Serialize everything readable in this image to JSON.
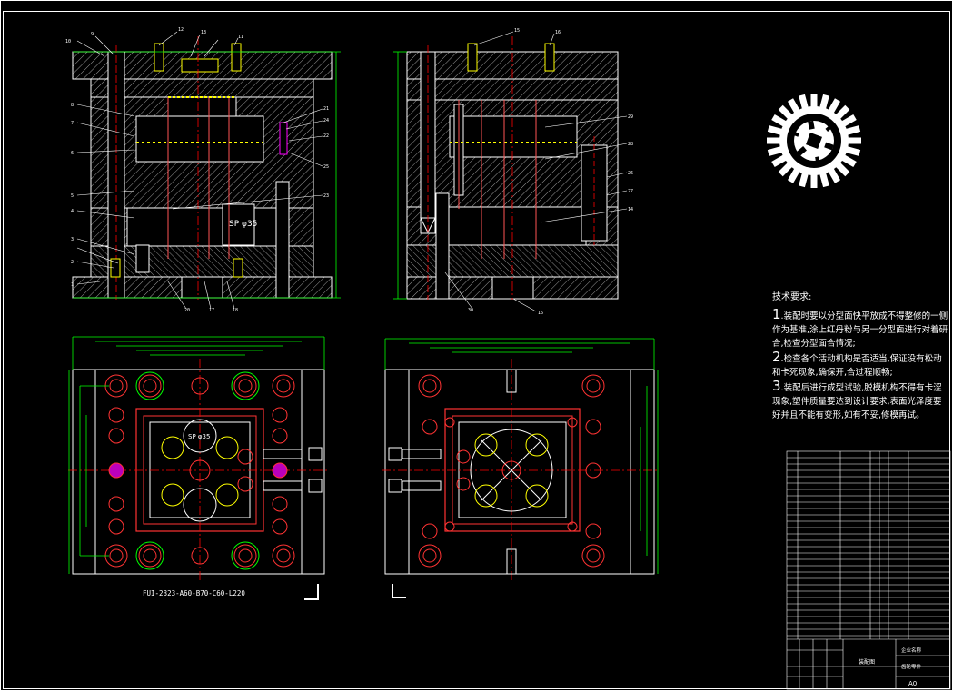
{
  "drawing": {
    "assembly_code": "FUI-2323-A60-B70-C60-L220",
    "sprue_note_top": "SP φ35",
    "sprue_note_plan": "SP φ35",
    "callouts_left_section": [
      "10",
      "9",
      "8",
      "7",
      "6",
      "5",
      "4",
      "3",
      "2",
      "1",
      "12",
      "13",
      "11",
      "21",
      "24",
      "22",
      "25",
      "23",
      "20",
      "17",
      "18",
      "19"
    ],
    "callouts_right_section": [
      "15",
      "16",
      "29",
      "28",
      "26",
      "27",
      "14",
      "30"
    ]
  },
  "technical_requirements": {
    "title": "技术要求:",
    "items": [
      {
        "num": "1",
        "text": ".装配时要以分型面快平放成不得整修的一侧作为基准,涂上红丹粉与另一分型面进行对着研合,检查分型面合情况;"
      },
      {
        "num": "2",
        "text": ".检查各个活动机构是否适当,保证没有松动和卡死现象,确保开,合过程顺畅;"
      },
      {
        "num": "3",
        "text": ".装配后进行成型试验,脱模机构不得有卡涩现象,塑件质量要达到设计要求,表面光泽度要好并且不能有变形,如有不妥,修模再试。"
      }
    ]
  },
  "title_block": {
    "name_label": "装配图",
    "company_line1": "企业名称",
    "company_line2": "齿轮零件",
    "sheet_size": "A0"
  }
}
